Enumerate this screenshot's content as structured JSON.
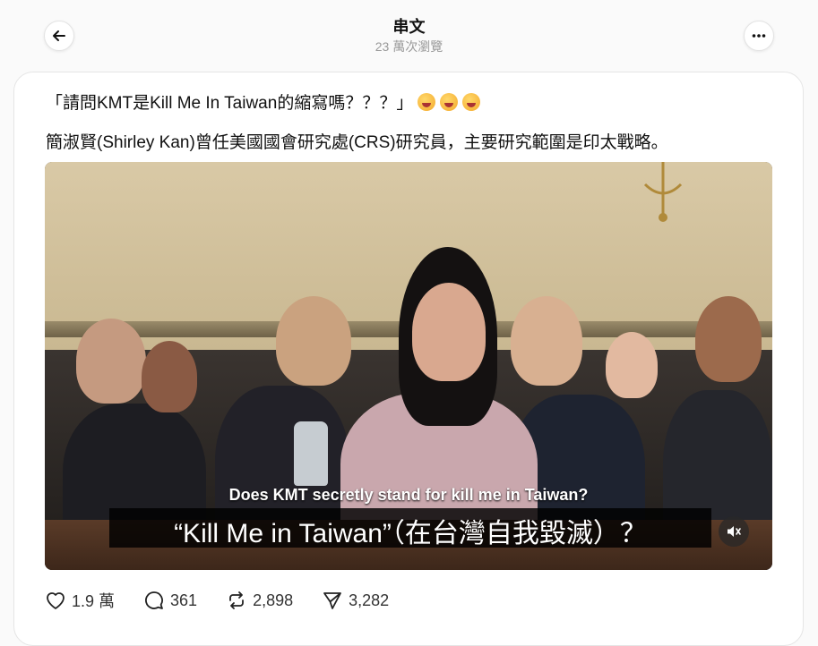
{
  "header": {
    "title": "串文",
    "views": "23 萬次瀏覽"
  },
  "post": {
    "line1": "「請問KMT是Kill Me In Taiwan的縮寫嗎？？？」",
    "emoji_count": 3,
    "emoji_icon": "rolling-on-floor-laughing",
    "line2": "簡淑賢(Shirley Kan)曾任美國國會研究處(CRS)研究員，主要研究範圍是印太戰略。"
  },
  "video": {
    "subtitle_en": "Does KMT secretly stand for kill me in Taiwan?",
    "subtitle_zh": "“Kill Me in Taiwan”（在台灣自我毀滅）？",
    "mute_icon": "speaker-muted"
  },
  "actions": {
    "likes": "1.9 萬",
    "replies": "361",
    "reposts": "2,898",
    "shares": "3,282"
  },
  "colors": {
    "background": "#fafafa",
    "card": "#ffffff",
    "muted_text": "#999999"
  }
}
